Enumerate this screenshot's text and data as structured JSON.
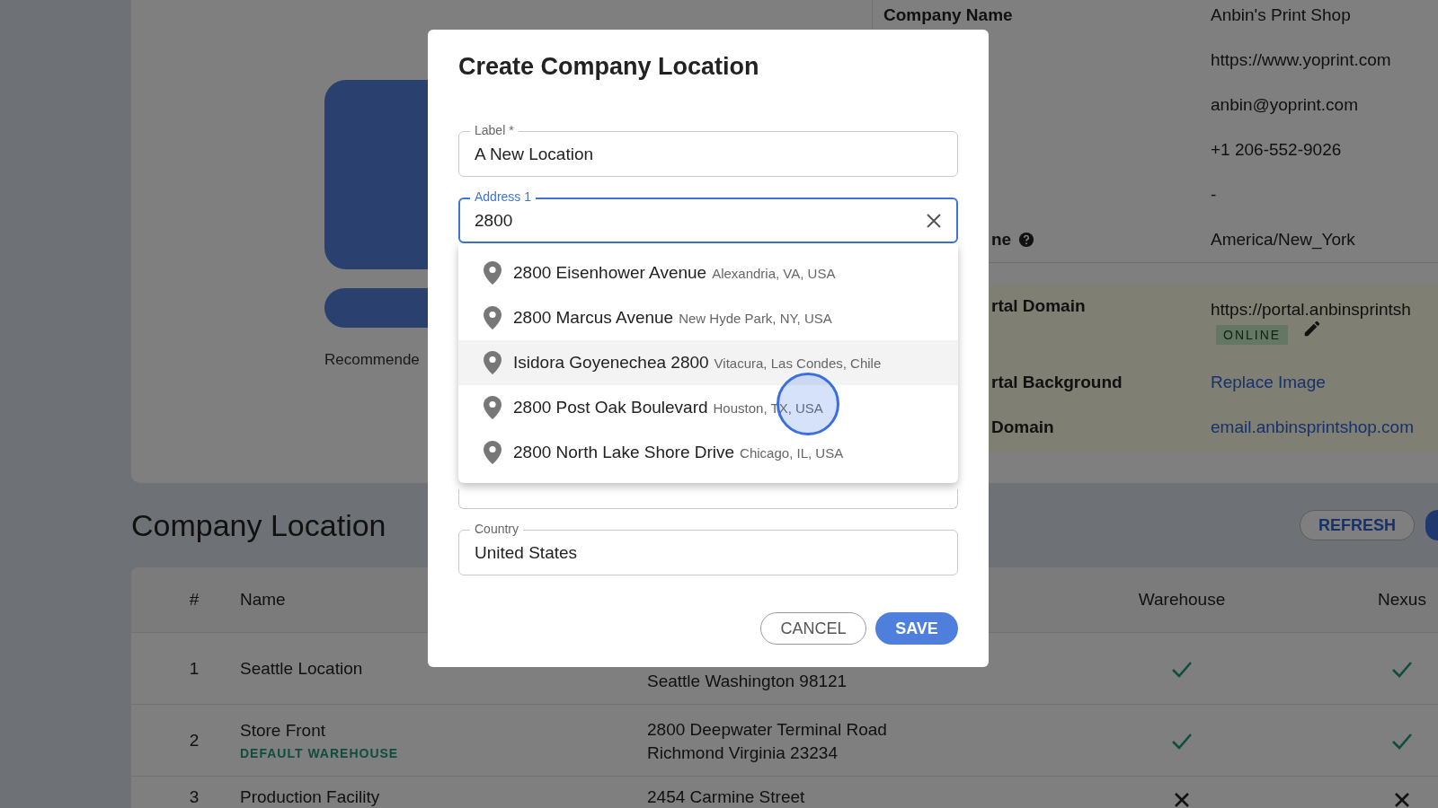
{
  "profile": {
    "recommended_text": "Recommende"
  },
  "company_info": {
    "rows": [
      {
        "label": "Company Name",
        "value": "Anbin's Print Shop"
      },
      {
        "value": "https://www.yoprint.com"
      },
      {
        "value": "anbin@yoprint.com"
      },
      {
        "value": "+1 206-552-9026"
      },
      {
        "value": "-"
      },
      {
        "label": "ne",
        "value": "America/New_York",
        "partly_hidden": true,
        "help": true
      }
    ]
  },
  "portal": {
    "rows": [
      {
        "label": "rtal Domain",
        "value": "https://portal.anbinsprintsh",
        "badge": "ONLINE",
        "editable": true,
        "partly_hidden": true
      },
      {
        "label": "rtal Background",
        "value": "Replace Image",
        "partly_hidden": true
      },
      {
        "label": "Domain",
        "value": "email.anbinsprintshop.com",
        "partly_hidden": true
      }
    ]
  },
  "company_location": {
    "title": "Company Location",
    "refresh_button": "REFRESH",
    "columns": [
      "#",
      "Name",
      "Warehouse",
      "Nexus"
    ],
    "rows": [
      {
        "number": "1",
        "name": "Seattle Location",
        "address": [
          "Seattle Washington 98121"
        ],
        "warehouse": true,
        "nexus": true
      },
      {
        "number": "2",
        "name": "Store Front",
        "tag": "DEFAULT WAREHOUSE",
        "address": [
          "2800 Deepwater Terminal Road",
          "Richmond Virginia 23234"
        ],
        "warehouse": true,
        "nexus": true
      },
      {
        "number": "3",
        "name": "Production Facility",
        "address": [
          "2454 Carmine Street"
        ],
        "warehouse": false,
        "nexus": false
      }
    ]
  },
  "dialog": {
    "title": "Create Company Location",
    "fields": [
      {
        "kind": "text",
        "label": "Label *",
        "value": "A New Location",
        "focused": false
      },
      {
        "kind": "autocomplete",
        "label": "Address 1",
        "value": "2800",
        "focused": true
      },
      {
        "kind": "text",
        "label": "Country",
        "value": "United States",
        "focused": false
      }
    ],
    "suggestions": [
      {
        "main": "2800 Eisenhower Avenue",
        "secondary": "Alexandria, VA, USA",
        "selected": false
      },
      {
        "main": "2800 Marcus Avenue",
        "secondary": "New Hyde Park, NY, USA",
        "selected": false
      },
      {
        "main": "Isidora Goyenechea 2800",
        "secondary": "Vitacura, Las Condes, Chile",
        "selected": true
      },
      {
        "main": "2800 Post Oak Boulevard",
        "secondary": "Houston, TX, USA",
        "selected": false
      },
      {
        "main": "2800 North Lake Shore Drive",
        "secondary": "Chicago, IL, USA",
        "selected": false
      }
    ],
    "cancel_button": "CANCEL",
    "save_button": "SAVE"
  }
}
